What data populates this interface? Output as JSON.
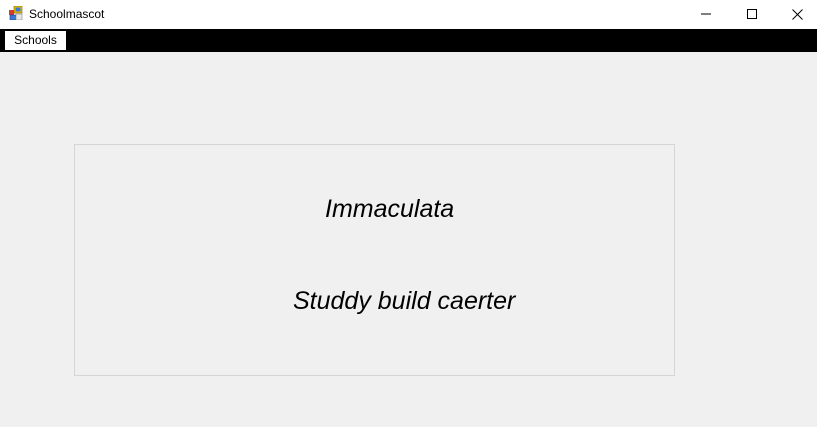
{
  "window": {
    "title": "Schoolmascot",
    "icon": "winforms-app-icon",
    "controls": {
      "minimize_icon": "minimize-icon",
      "maximize_icon": "maximize-icon",
      "close_icon": "close-icon"
    }
  },
  "menu": {
    "items": [
      {
        "label": "Schools"
      }
    ]
  },
  "content": {
    "school_name": "Immaculata",
    "motto": "Studdy build caerter"
  },
  "colors": {
    "background": "#f0f0f0",
    "menubar": "#000000",
    "titlebar": "#ffffff",
    "panel_border": "#d5d5d5"
  }
}
